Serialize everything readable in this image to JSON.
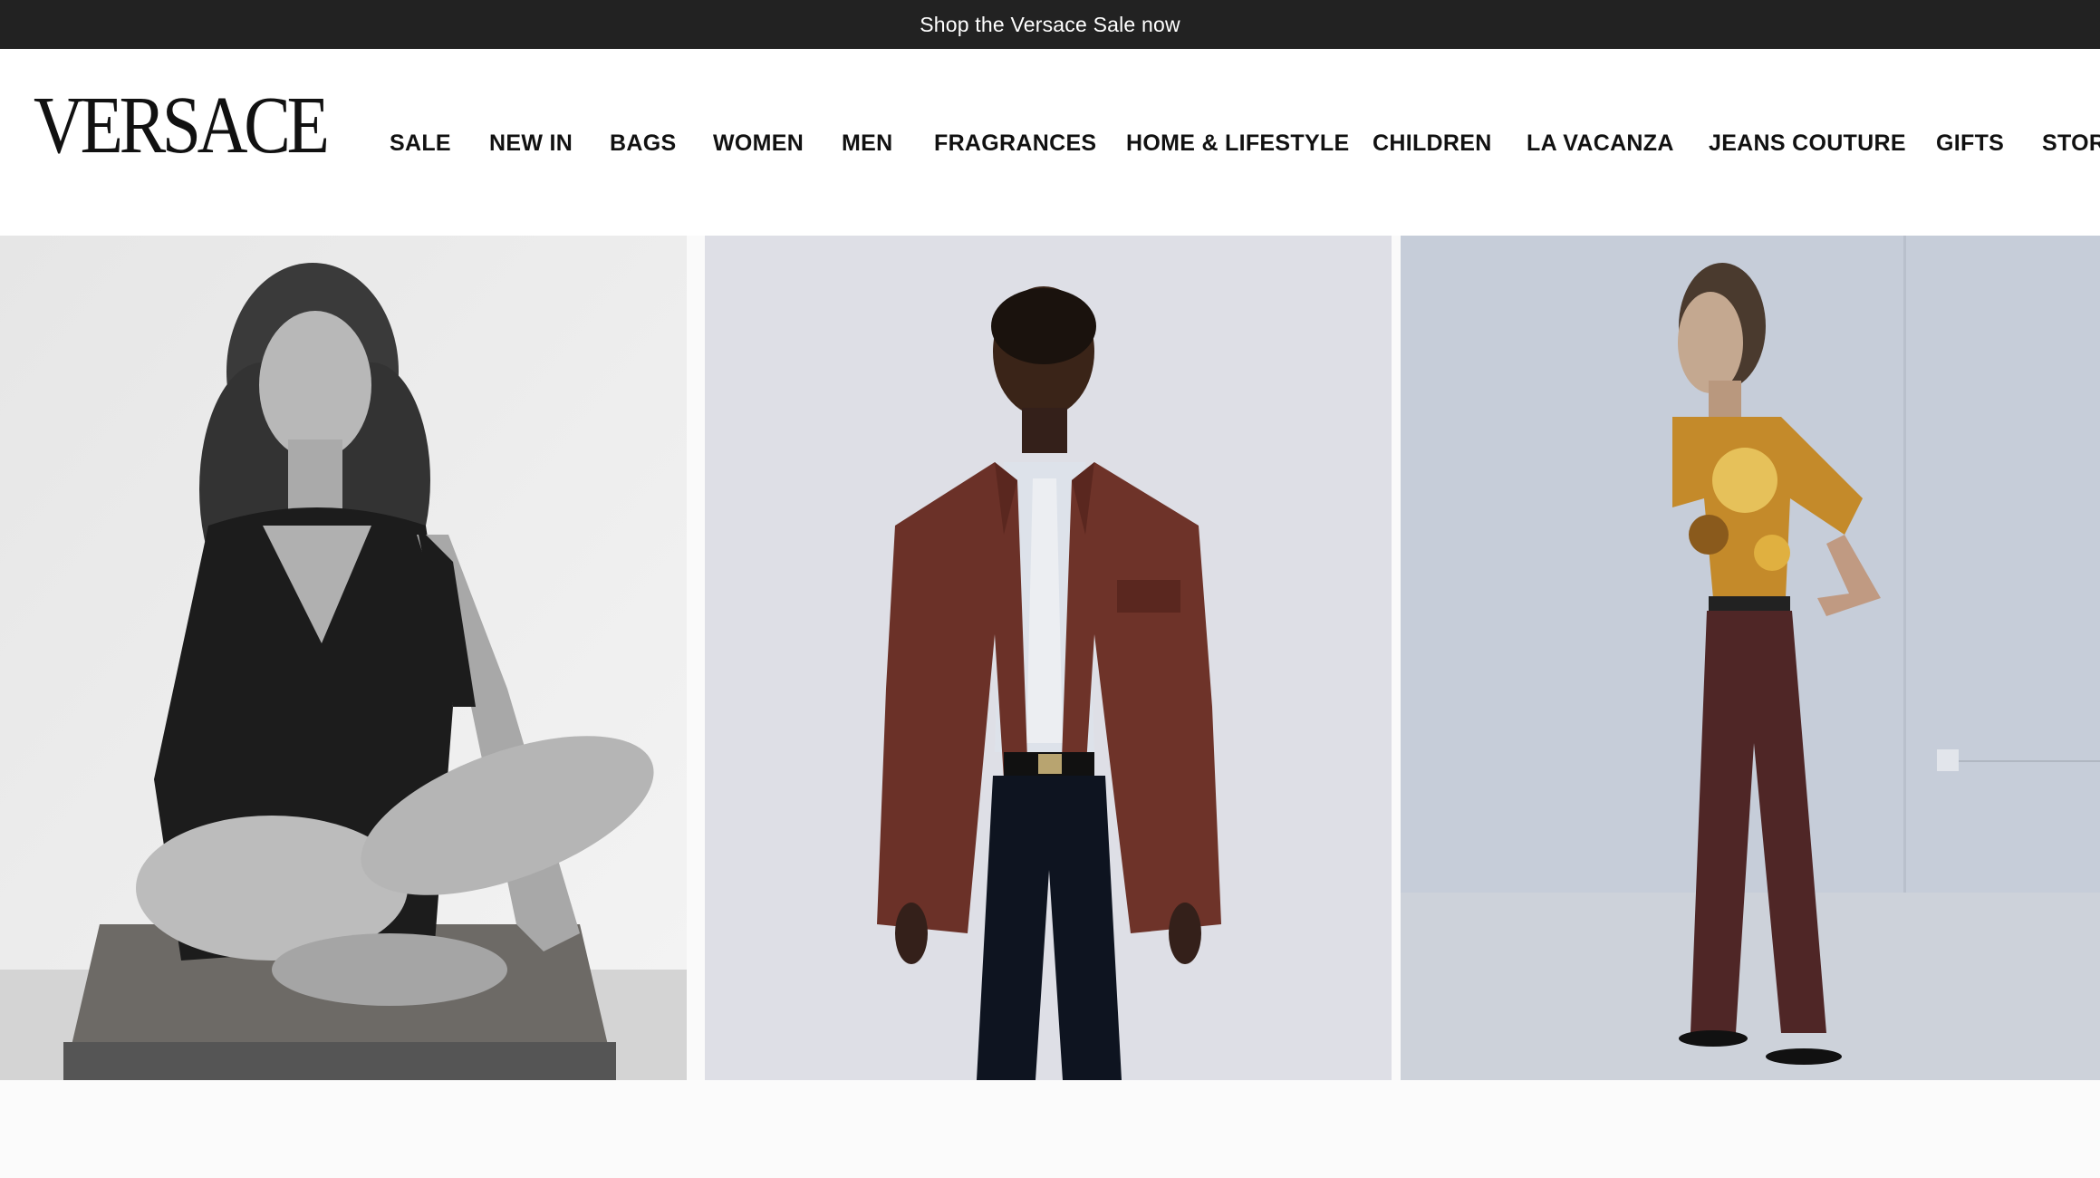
{
  "promo": {
    "text": "Shop the Versace Sale now",
    "link": ""
  },
  "brand": {
    "logo_text": "VERSACE"
  },
  "nav": {
    "items": [
      {
        "label": "SALE"
      },
      {
        "label": "NEW IN"
      },
      {
        "label": "BAGS"
      },
      {
        "label": "WOMEN"
      },
      {
        "label": "MEN"
      },
      {
        "label": "FRAGRANCES"
      },
      {
        "label": "HOME & LIFESTYLE"
      },
      {
        "label": "CHILDREN"
      },
      {
        "label": "LA VACANZA"
      },
      {
        "label": "JEANS COUTURE"
      },
      {
        "label": "GIFTS"
      },
      {
        "label": "STOR"
      }
    ]
  },
  "gallery": {
    "tiles": [
      {
        "subject": "woman in black knit dress seated on wooden crate",
        "style": "black-and-white"
      },
      {
        "subject": "man in brown leather jacket, white shirt and tie",
        "style": "color"
      },
      {
        "subject": "woman in gold baroque shirt and brown leather trousers",
        "style": "color"
      }
    ]
  },
  "colors": {
    "promo_bg": "#222222",
    "header_bg": "#ffffff",
    "text": "#111111"
  }
}
